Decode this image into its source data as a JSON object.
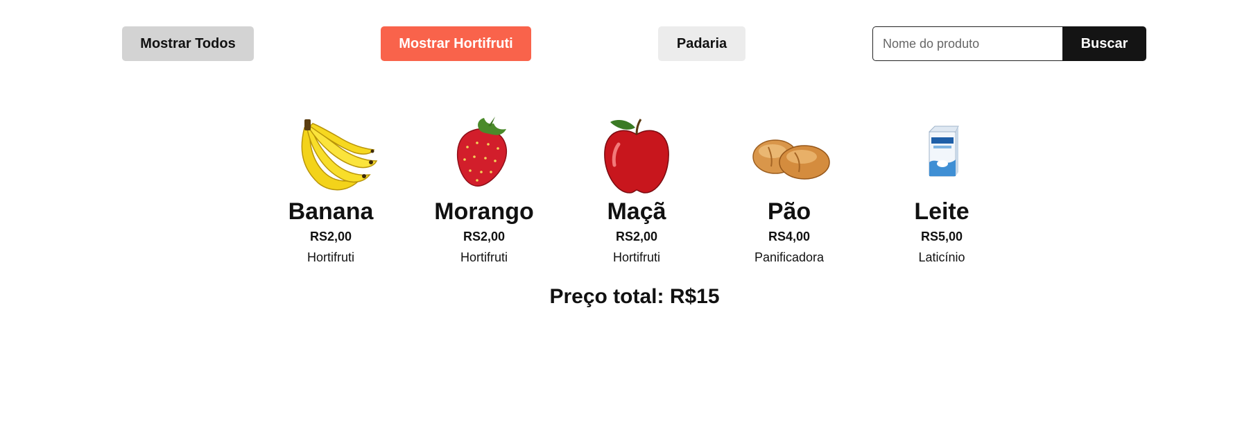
{
  "filters": {
    "show_all": "Mostrar Todos",
    "show_hortifruti": "Mostrar Hortifruti",
    "padaria": "Padaria"
  },
  "search": {
    "placeholder": "Nome do produto",
    "value": "",
    "button": "Buscar"
  },
  "products": [
    {
      "name": "Banana",
      "price": "RS2,00",
      "category": "Hortifruti",
      "icon": "banana-icon"
    },
    {
      "name": "Morango",
      "price": "RS2,00",
      "category": "Hortifruti",
      "icon": "strawberry-icon"
    },
    {
      "name": "Maçã",
      "price": "RS2,00",
      "category": "Hortifruti",
      "icon": "apple-icon"
    },
    {
      "name": "Pão",
      "price": "RS4,00",
      "category": "Panificadora",
      "icon": "bread-icon"
    },
    {
      "name": "Leite",
      "price": "RS5,00",
      "category": "Laticínio",
      "icon": "milk-carton-icon"
    }
  ],
  "total": {
    "label": "Preço total: R$15"
  },
  "colors": {
    "accent": "#f9634b",
    "search_button": "#141414",
    "neutral_button": "#d3d3d3",
    "light_button": "#ececec"
  }
}
